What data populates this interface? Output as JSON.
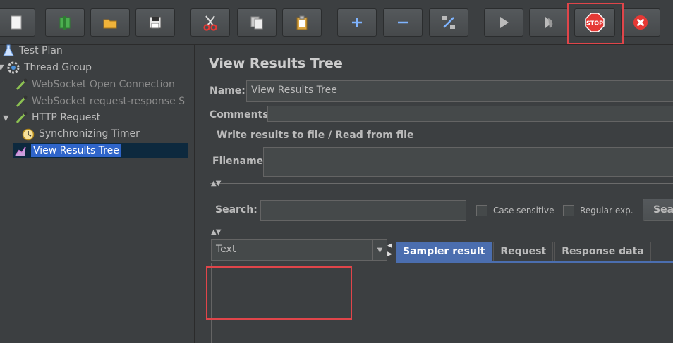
{
  "toolbar": {
    "buttons": [
      "new-icon",
      "templates-icon",
      "open-icon",
      "save-icon",
      "cut-icon",
      "copy-icon",
      "paste-icon",
      "expand-icon",
      "collapse-icon",
      "toggle-icon",
      "start-icon",
      "start-no-pause-icon",
      "stop-icon",
      "shutdown-icon"
    ],
    "stop_label": "STOP",
    "accent_highlight": "#e0454a"
  },
  "tree": {
    "items": [
      {
        "label": "Test Plan",
        "icon": "flask-icon"
      },
      {
        "label": "Thread Group",
        "icon": "gear-icon"
      },
      {
        "label": "WebSocket Open Connection",
        "icon": "dropper-icon"
      },
      {
        "label": "WebSocket request-response S",
        "icon": "dropper-icon"
      },
      {
        "label": "HTTP Request",
        "icon": "dropper-icon"
      },
      {
        "label": "Synchronizing Timer",
        "icon": "timer-icon"
      },
      {
        "label": "View Results Tree",
        "icon": "chart-icon",
        "selected": true
      }
    ]
  },
  "panel": {
    "title": "View Results Tree",
    "name_label": "Name:",
    "name_value": "View Results Tree",
    "comments_label": "Comments:",
    "group_title": "Write results to file / Read from file",
    "filename_label": "Filename",
    "search_label": "Search:",
    "case_sensitive": "Case sensitive",
    "regular_exp": "Regular exp.",
    "search_button": "Sea",
    "renderer_value": "Text",
    "tabs": [
      "Sampler result",
      "Request",
      "Response data"
    ]
  }
}
